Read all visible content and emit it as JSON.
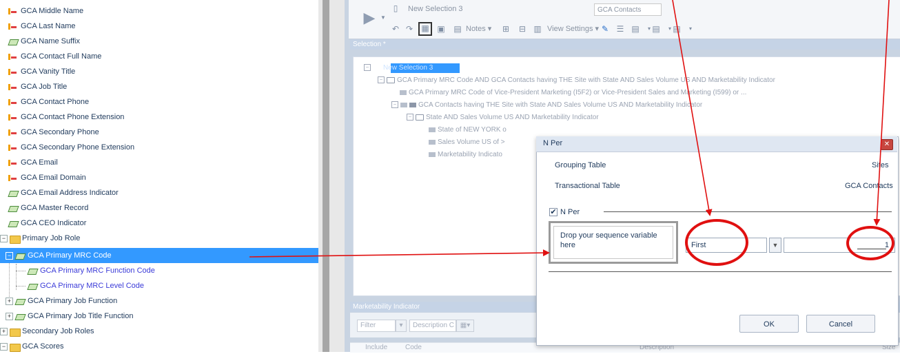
{
  "tree": {
    "items": [
      {
        "label": "GCA Middle Name",
        "icon": "field-icon"
      },
      {
        "label": "GCA Last Name",
        "icon": "field-icon"
      },
      {
        "label": "GCA Name Suffix",
        "icon": "code-icon"
      },
      {
        "label": "GCA Contact Full Name",
        "icon": "field-icon"
      },
      {
        "label": "GCA Vanity Title",
        "icon": "field-icon"
      },
      {
        "label": "GCA Job Title",
        "icon": "field-icon"
      },
      {
        "label": "GCA Contact Phone",
        "icon": "field-icon"
      },
      {
        "label": "GCA Contact Phone Extension",
        "icon": "field-icon"
      },
      {
        "label": "GCA Secondary Phone",
        "icon": "field-icon"
      },
      {
        "label": "GCA Secondary Phone Extension",
        "icon": "field-icon"
      },
      {
        "label": "GCA Email",
        "icon": "field-icon"
      },
      {
        "label": "GCA Email Domain",
        "icon": "field-icon"
      },
      {
        "label": "GCA Email Address Indicator",
        "icon": "code-icon"
      },
      {
        "label": "GCA Master Record",
        "icon": "code-icon"
      },
      {
        "label": "GCA CEO Indicator",
        "icon": "code-icon"
      },
      {
        "label": "Primary Job Role",
        "icon": "folder-icon"
      },
      {
        "label": "GCA Primary MRC Code",
        "icon": "code-icon"
      },
      {
        "label": "GCA Primary MRC Function Code",
        "icon": "code-icon"
      },
      {
        "label": "GCA Primary MRC Level Code",
        "icon": "code-icon"
      },
      {
        "label": "GCA Primary Job Function",
        "icon": "code-icon"
      },
      {
        "label": "GCA Primary Job Title Function",
        "icon": "code-icon"
      },
      {
        "label": "Secondary Job Roles",
        "icon": "folder-icon"
      },
      {
        "label": "GCA Scores",
        "icon": "folder-icon"
      }
    ]
  },
  "toolbar": {
    "selection_name": "New Selection 3",
    "table_name": "GCA Contacts",
    "notes_label": "Notes",
    "view_settings_label": "View Settings"
  },
  "selection": {
    "header": "Selection *",
    "root_label": "New Selection 3",
    "lines": [
      "GCA Primary MRC Code AND GCA Contacts having THE Site with State AND Sales Volume US AND Marketability Indicator",
      "GCA Primary MRC Code of Vice-President Marketing (I5F2) or Vice-President Sales and Marketing (I599) or ...",
      "GCA Contacts having THE Site with State AND Sales Volume US AND Marketability Indicator",
      "State AND Sales Volume US AND Marketability Indicator",
      "State of NEW YORK o",
      "Sales Volume US of >",
      "Marketability Indicato"
    ]
  },
  "marketability": {
    "header": "Marketability Indicator",
    "filter_label": "Filter",
    "description_label": "Description C",
    "col_include": "Include",
    "col_code": "Code",
    "col_description": "Description",
    "col_size": "Size"
  },
  "dialog": {
    "title": "N Per",
    "grouping_label": "Grouping Table",
    "grouping_value": "Sites",
    "transactional_label": "Transactional Table",
    "transactional_value": "GCA Contacts",
    "nper_checkbox_label": "N Per",
    "nper_checked": true,
    "drop_zone_text": "Drop your sequence variable here",
    "sequence_selected": "First",
    "count_value": "1",
    "ok_label": "OK",
    "cancel_label": "Cancel"
  },
  "colors": {
    "selection_highlight": "#3399ff",
    "annotation_red": "#e01010",
    "field_link_blue": "#3b3bd8"
  }
}
